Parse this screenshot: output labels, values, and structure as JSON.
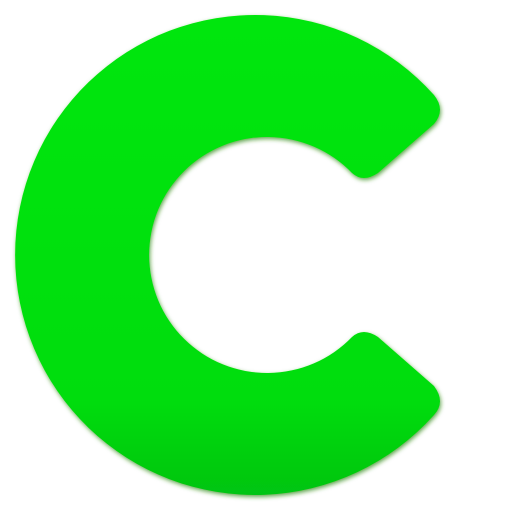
{
  "logo": {
    "icon": "letter-c-logo",
    "colors": {
      "fill_top": "#00e60a",
      "fill_bottom": "#00c412",
      "edge_shadow": "#2f8a16",
      "background": "#ffffff"
    }
  }
}
